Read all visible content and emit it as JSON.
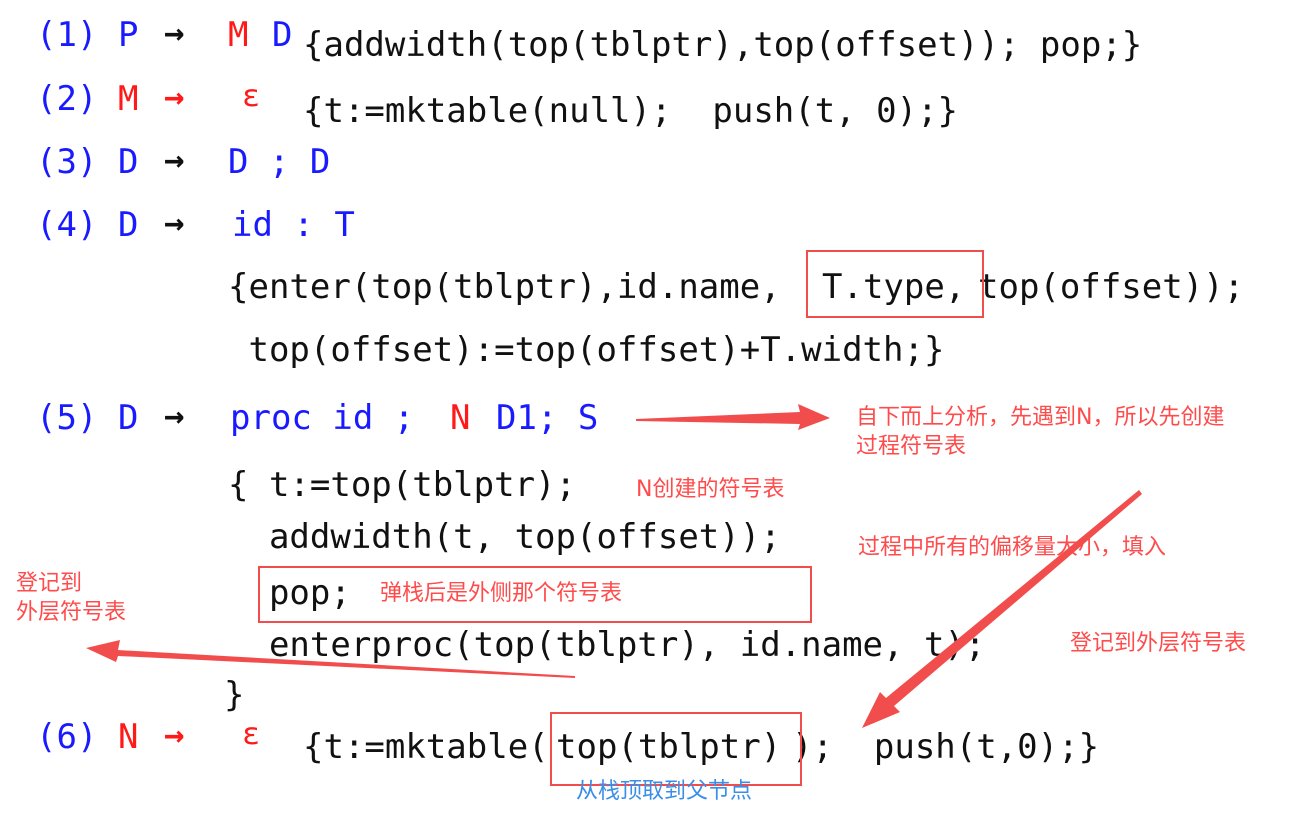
{
  "rules": [
    {
      "num": "(1)",
      "lhs": "P",
      "arrow": "→",
      "rhs1": "M",
      "rhs2": "D",
      "action": "{addwidth(top(tblptr),top(offset)); pop;}"
    },
    {
      "num": "(2)",
      "lhs": "M",
      "arrow": "→",
      "rhs": "ε",
      "action": "{t:=mktable(null);  push(t, 0);}"
    },
    {
      "num": "(3)",
      "lhs": "D",
      "arrow": "→",
      "rhs": "D ; D"
    },
    {
      "num": "(4)",
      "lhs": "D",
      "arrow": "→",
      "rhs": "id : T",
      "action_line1_a": "{enter(top(tblptr),id.name,",
      "action_line1_b": "T.type,",
      "action_line1_c": "top(offset));",
      "action_line2": " top(offset):=top(offset)+T.width;}"
    },
    {
      "num": "(5)",
      "lhs": "D",
      "arrow": "→",
      "rhs_a": "proc id ;",
      "rhs_b": "N",
      "rhs_c": "D1; S",
      "action_line1": "{ t:=top(tblptr);",
      "action_line2": "  addwidth(t, top(offset));",
      "action_line3": "  pop;",
      "action_line4": "  enterproc(top(tblptr), id.name, t);",
      "action_line5": "}"
    },
    {
      "num": "(6)",
      "lhs": "N",
      "arrow": "→",
      "rhs": "ε",
      "action_a": "{t:=mktable(",
      "action_b": "top(tblptr)",
      "action_c": ");  push(t,0);}"
    }
  ],
  "annotations": {
    "bottom_up": "自下而上分析，先遇到N，所以先创建\n过程符号表",
    "n_created": "N创建的符号表",
    "fill_offsets": "过程中所有的偏移量大小，填入",
    "pop_outer": "弹栈后是外侧那个符号表",
    "register_left": "登记到\n外层符号表",
    "register_right": "登记到外层符号表",
    "parent_from_stack": "从栈顶取到父节点"
  },
  "colors": {
    "blue": "#1a1aff",
    "red": "#ff1a1a",
    "annotation": "#ff4b4b",
    "annotation_blue": "#3a8ee8",
    "box": "#f24d4d"
  }
}
